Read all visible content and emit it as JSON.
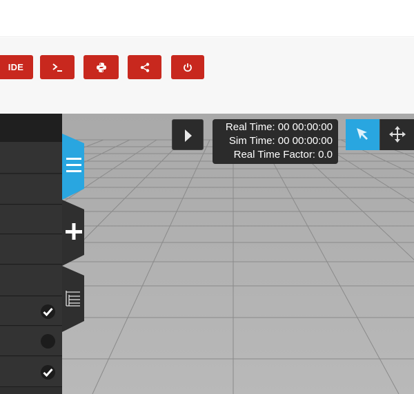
{
  "toolbar": {
    "ide_label": "IDE",
    "terminal_icon": "terminal-icon",
    "python_icon": "python-icon",
    "share_icon": "share-icon",
    "power_icon": "power-icon",
    "accent_color": "#c8281e"
  },
  "sim": {
    "real_time": "Real Time: 00 00:00:00",
    "sim_time": "Sim Time: 00 00:00:00",
    "real_time_factor": "Real Time Factor: 0.0",
    "play_icon": "play-icon"
  },
  "mode": {
    "select_icon": "cursor-arrow-icon",
    "translate_icon": "move-arrows-icon",
    "active_color": "#29a6e0"
  },
  "sidetabs": [
    {
      "icon": "menu-icon",
      "active": true
    },
    {
      "icon": "plus-icon",
      "active": false
    },
    {
      "icon": "tree-list-icon",
      "active": false
    }
  ],
  "leftpanel": {
    "rows": [
      {
        "check": "none"
      },
      {
        "check": "none"
      },
      {
        "check": "none"
      },
      {
        "check": "none"
      },
      {
        "check": "none"
      },
      {
        "check": "checked"
      },
      {
        "check": "unchecked"
      },
      {
        "check": "checked"
      }
    ]
  }
}
